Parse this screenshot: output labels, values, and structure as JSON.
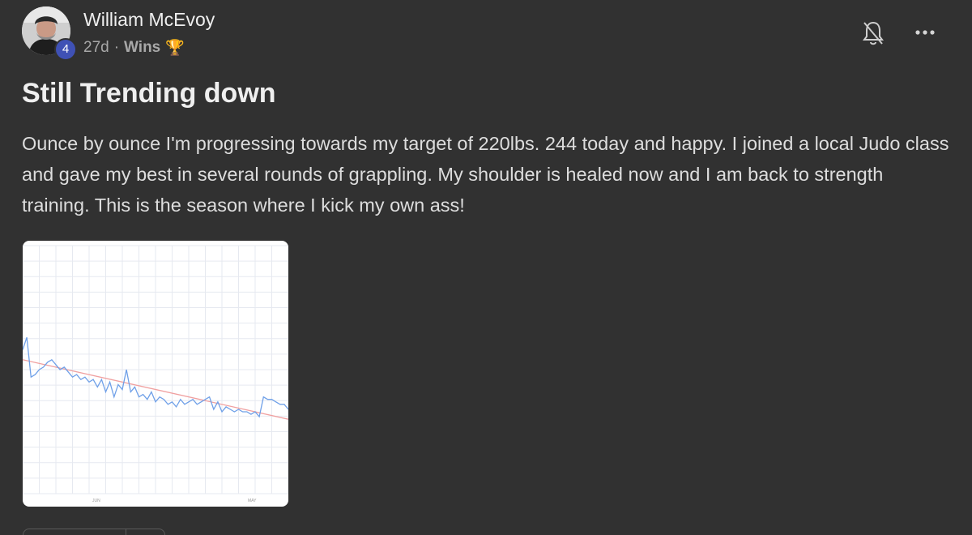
{
  "author": {
    "name": "William McEvoy",
    "level": "4",
    "avatar_icon": "user-photo-icon"
  },
  "meta": {
    "age": "27d",
    "separator": "·",
    "category": "Wins",
    "category_icon": "🏆"
  },
  "actions": {
    "bell_icon": "bell-off-icon",
    "more_icon": "more-horizontal-icon",
    "more_glyph": "•••"
  },
  "post": {
    "title": "Still Trending down",
    "body": "Ounce by ounce I'm progressing towards my target of 220lbs. 244 today and happy. I joined a local Judo class and gave my best in several rounds of grappling. My shoulder is healed now and I am back to strength training. This is the season where I kick my own ass!"
  },
  "colors": {
    "background": "#313131",
    "badge": "#3f51b5",
    "weight_line": "#6fa0e8",
    "trend_line": "#f0a0a0",
    "grid": "#e6e9f0"
  },
  "chart_data": {
    "type": "line",
    "title": "",
    "xlabel": "",
    "ylabel": "",
    "x_ticks": [
      "JUN",
      "MAY"
    ],
    "grid": true,
    "legend": "none",
    "ylim": [
      0,
      100
    ],
    "series": [
      {
        "values": [
          58,
          63,
          47,
          48,
          50,
          51,
          53,
          54,
          52,
          50,
          51,
          49,
          47,
          48,
          46,
          47,
          45,
          46,
          43,
          46,
          41,
          45,
          39,
          44,
          42,
          50,
          41,
          43,
          39,
          40,
          38,
          41,
          37,
          39,
          38,
          36,
          37,
          35,
          38,
          36,
          37,
          38,
          36,
          37,
          38,
          39,
          34,
          37,
          33,
          35,
          34,
          33,
          34,
          33,
          33,
          32,
          33,
          31,
          39,
          38,
          38,
          37,
          36,
          36,
          34
        ]
      },
      {
        "values": [
          54,
          30
        ]
      }
    ]
  }
}
